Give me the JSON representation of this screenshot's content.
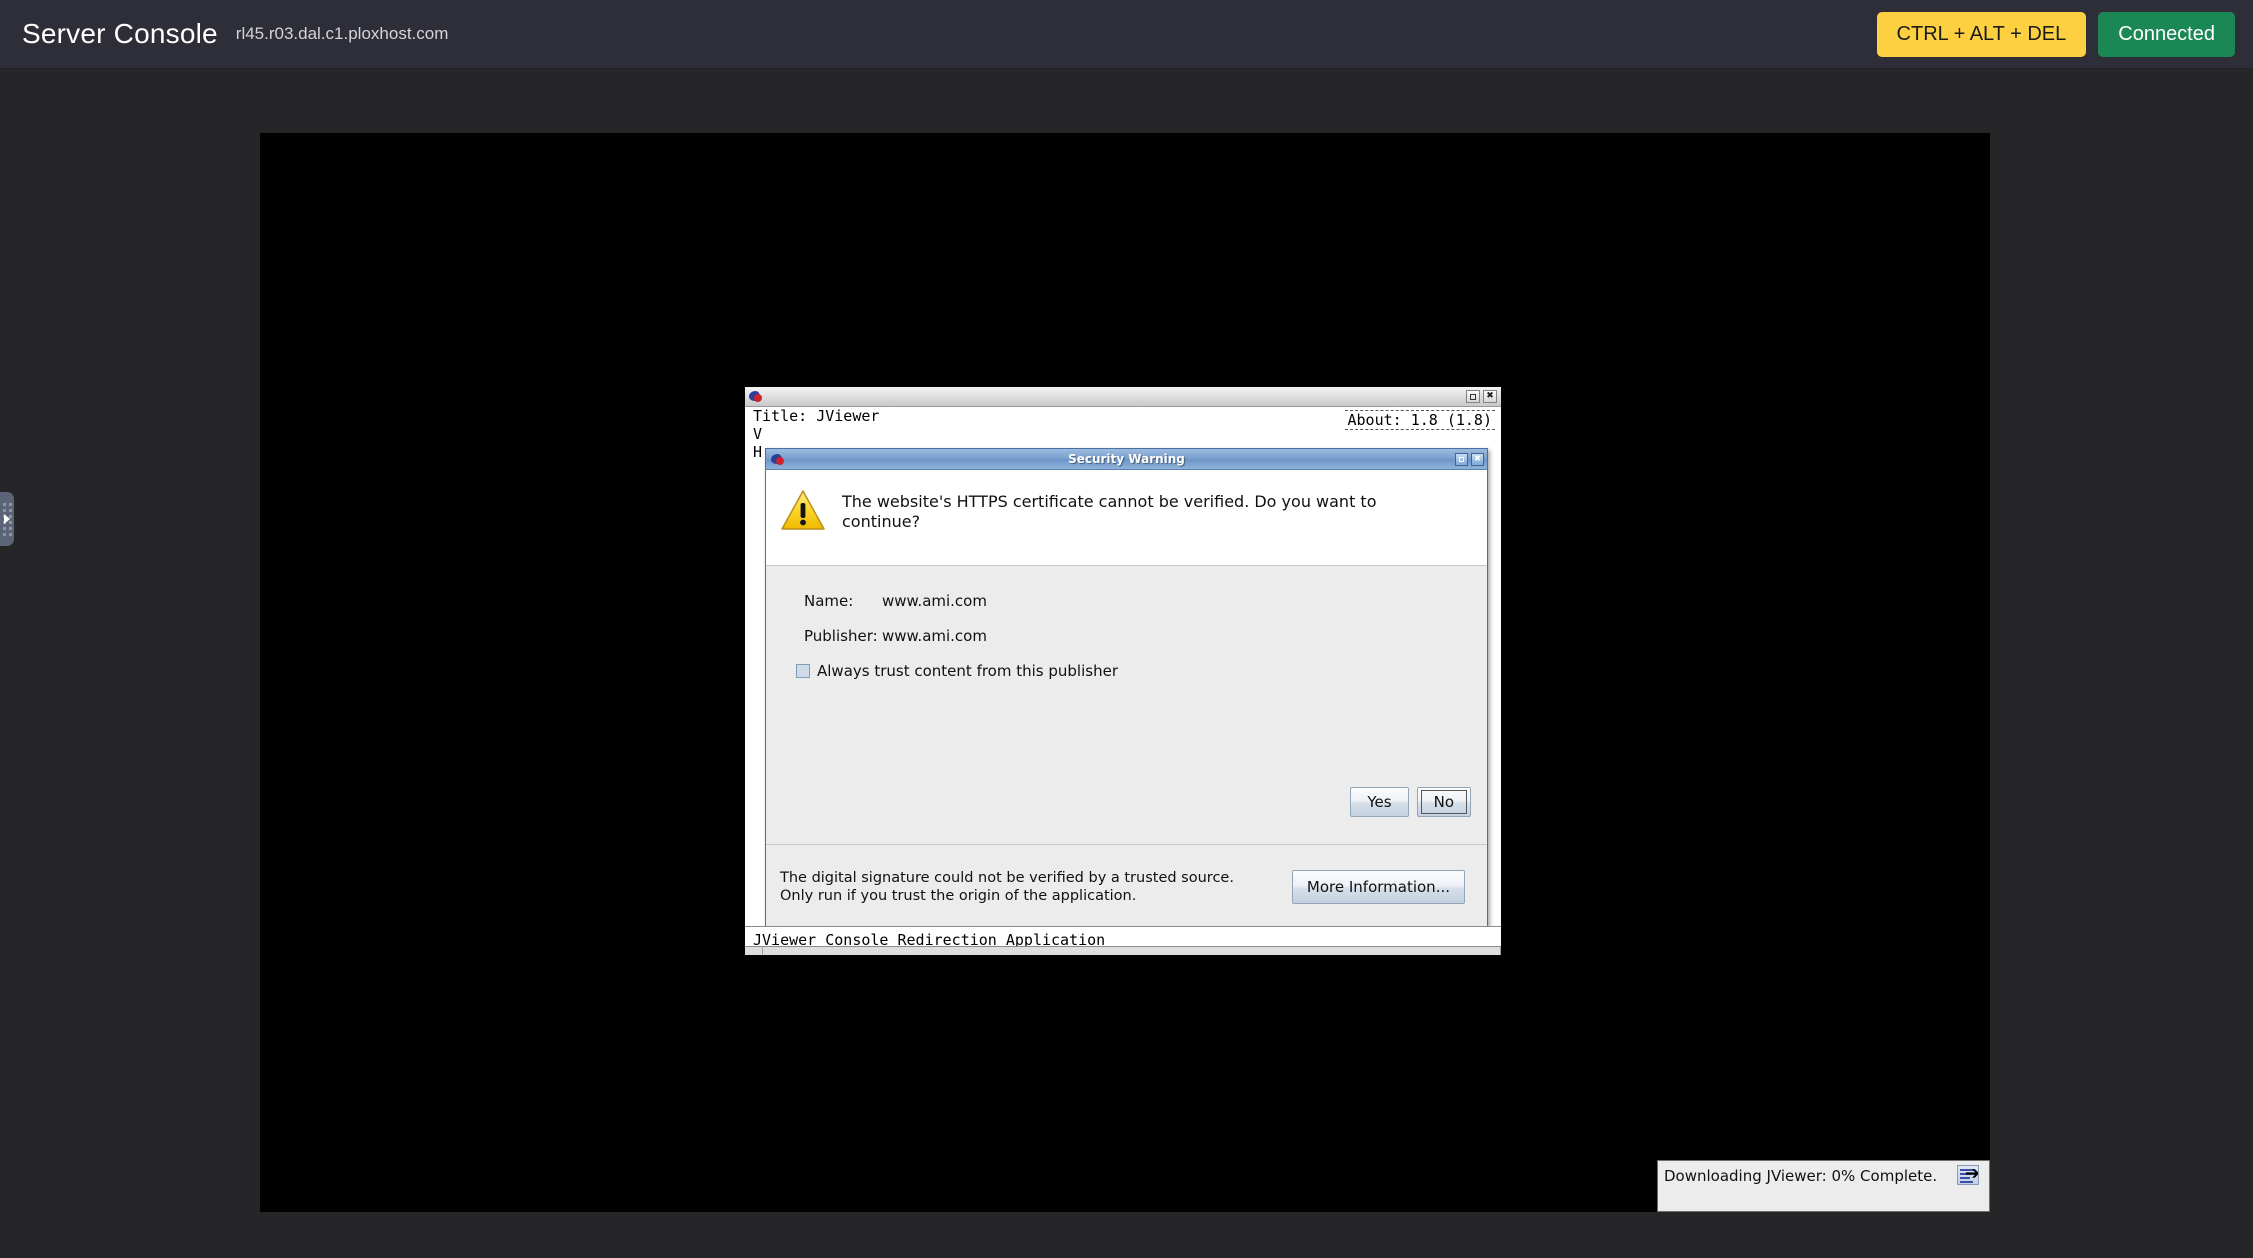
{
  "header": {
    "title": "Server Console",
    "hostname": "rl45.r03.dal.c1.ploxhost.com",
    "ctrl_alt_del_label": "CTRL + ALT + DEL",
    "connection_status": "Connected",
    "accent_warning_color": "#fcd041",
    "accent_connected_color": "#1b8754",
    "bar_color": "#2e2e38"
  },
  "sidebar_handle": {
    "icon": "drawer-expand-arrow-icon"
  },
  "console": {
    "background_color": "#000000"
  },
  "jviewer_window": {
    "icon": "java-cup-icon",
    "title_line": "Title: JViewer",
    "line2": "V",
    "line3": "H",
    "about": "About: 1.8 (1.8)",
    "status_text": "JViewer Console Redirection Application",
    "controls": {
      "maximize": "maximize-icon",
      "close": "✖"
    }
  },
  "security_dialog": {
    "title": "Security Warning",
    "icon": "warning-triangle-icon",
    "message": "The website's HTTPS certificate cannot be verified. Do you want to continue?",
    "details": [
      {
        "label": "Name:",
        "value": "www.ami.com"
      },
      {
        "label": "Publisher:",
        "value": "www.ami.com"
      }
    ],
    "trust_checkbox_label": "Always trust content from this publisher",
    "trust_checkbox_checked": false,
    "yes_label": "Yes",
    "no_label": "No",
    "focused_button": "No",
    "signature_note": "The digital signature could not be verified by a trusted source. Only run if you trust the origin of the application.",
    "more_information_label": "More Information...",
    "controls": {
      "maximize": "maximize-icon",
      "close": "✖"
    }
  },
  "download_toast": {
    "text": "Downloading JViewer: 0% Complete.",
    "percent": 0,
    "icon": "download-document-icon"
  }
}
